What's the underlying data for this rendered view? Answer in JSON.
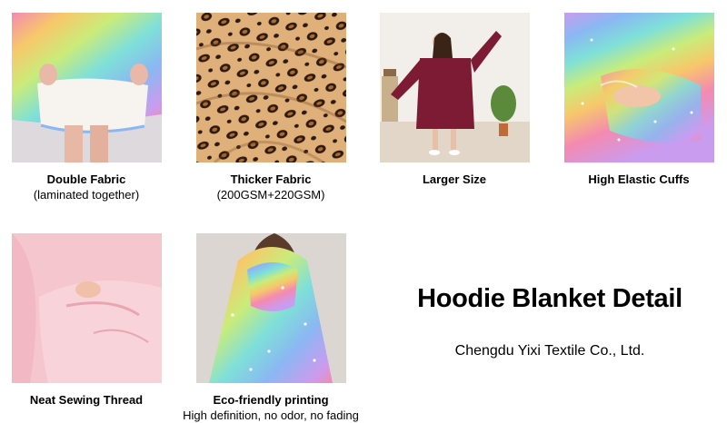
{
  "products": [
    {
      "title": "Double Fabric",
      "subtitle": "(laminated together)",
      "image": "rainbow-sherpa-lining-photo"
    },
    {
      "title": "Thicker Fabric",
      "subtitle": "(200GSM+220GSM)",
      "image": "leopard-fabric-photo"
    },
    {
      "title": "Larger Size",
      "subtitle": "",
      "image": "woman-in-burgundy-hoodie-photo"
    },
    {
      "title": "High Elastic Cuffs",
      "subtitle": "",
      "image": "rainbow-cuff-pocket-photo"
    },
    {
      "title": "Neat Sewing Thread",
      "subtitle": "",
      "image": "pink-hoodie-pocket-photo"
    },
    {
      "title": "Eco-friendly printing",
      "subtitle": "High definition, no odor, no fading",
      "image": "rainbow-hood-back-photo"
    }
  ],
  "headline": "Hoodie Blanket Detail",
  "company": "Chengdu Yixi Textile Co., Ltd.",
  "colors": {
    "rainbow": [
      "#f48ab0",
      "#f7c86a",
      "#c9ec7a",
      "#7fe0d8",
      "#8ab8f2",
      "#c99cf0"
    ],
    "burgundy": "#7d1a34",
    "pink": "#f6c6cf",
    "leopard": "#d49a5a"
  }
}
